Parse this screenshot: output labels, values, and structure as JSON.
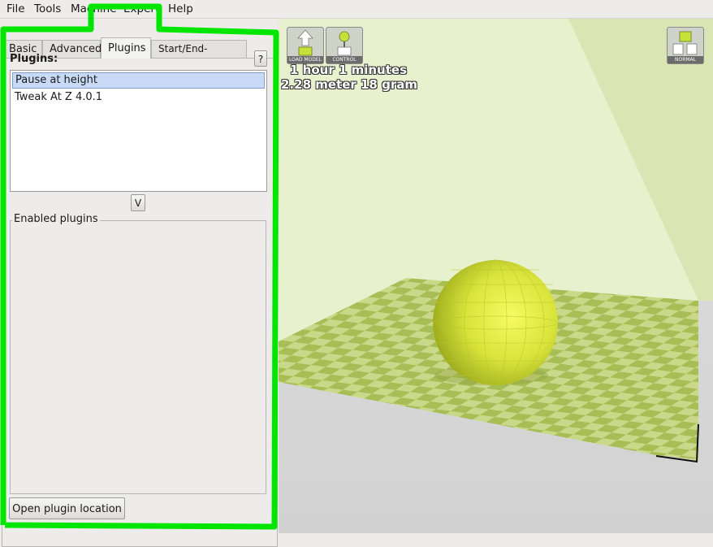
{
  "menu": {
    "items": [
      {
        "label": "File"
      },
      {
        "label": "Tools"
      },
      {
        "label": "Machine"
      },
      {
        "label": "Expert"
      },
      {
        "label": "Help"
      }
    ]
  },
  "tabs": [
    {
      "label": "Basic"
    },
    {
      "label": "Advanced"
    },
    {
      "label": "Plugins",
      "active": true
    },
    {
      "label": "Start/End-GCode"
    }
  ],
  "plugins_panel": {
    "heading": "Plugins:",
    "help_label": "?",
    "list": [
      {
        "label": "Pause at height",
        "selected": true
      },
      {
        "label": "Tweak At Z 4.0.1",
        "selected": false
      }
    ],
    "add_label": "V",
    "enabled_group_label": "Enabled plugins",
    "open_location_label": "Open plugin location"
  },
  "viewport": {
    "tool_buttons": [
      {
        "icon": "load-model-icon",
        "caption": "LOAD MODEL"
      },
      {
        "icon": "control-icon",
        "caption": "CONTROL"
      },
      {
        "icon": "view-mode-icon",
        "caption": "NORMAL"
      }
    ],
    "print_time": "1 hour 1 minutes",
    "print_usage": "2.28 meter 18 gram"
  },
  "colors": {
    "highlight": "#00e600",
    "model": "#e2f040",
    "bed_light": "#c9d889",
    "bed_dark": "#a7bd55"
  }
}
